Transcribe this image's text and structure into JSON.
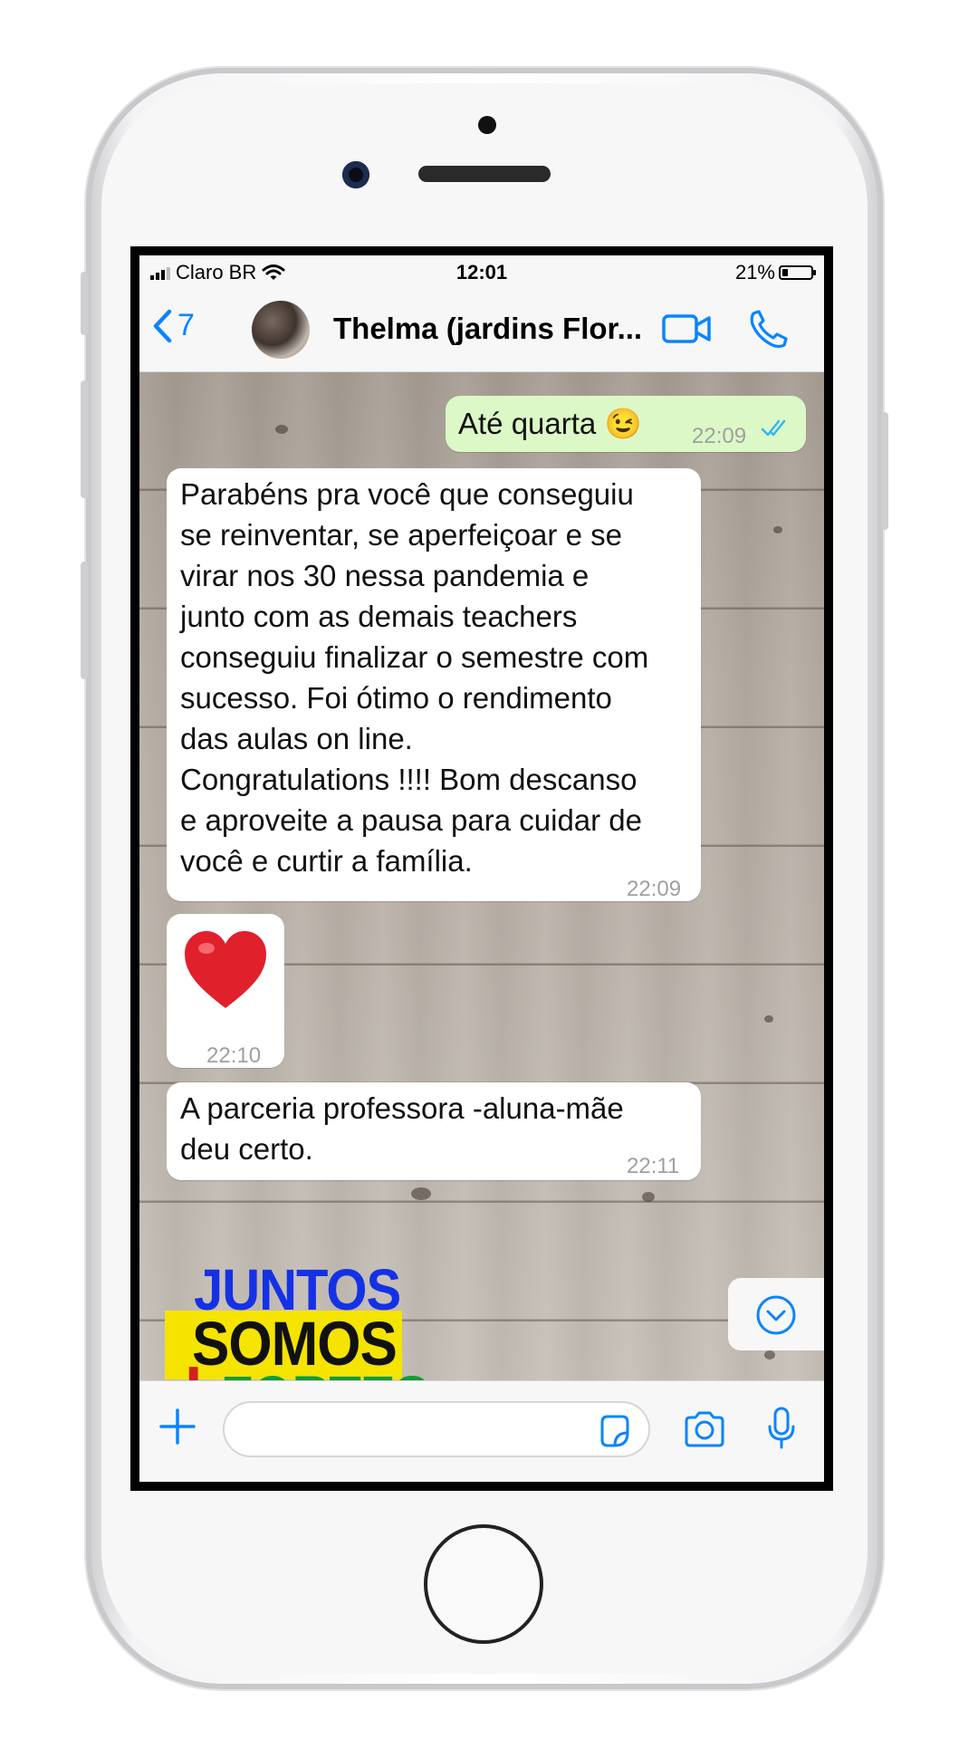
{
  "status_bar": {
    "carrier": "Claro BR",
    "time": "12:01",
    "battery_percent": "21%",
    "battery_level": 0.21
  },
  "header": {
    "back_count": "7",
    "contact_name": "Thelma (jardins Flor..."
  },
  "messages": [
    {
      "direction": "outgoing",
      "text": "Até quarta 😉",
      "time": "22:09",
      "status": "read"
    },
    {
      "direction": "incoming",
      "text": "Parabéns pra você que conseguiu\nse reinventar, se aperfeiçoar e se\nvirar nos 30 nessa pandemia e\njunto com as demais teachers\nconseguiu finalizar o semestre com\nsucesso. Foi ótimo o rendimento\ndas aulas on line.\nCongratulations !!!! Bom descanso\ne aproveite a pausa para cuidar de\nvocê e curtir a família.",
      "time": "22:09"
    },
    {
      "direction": "incoming",
      "text": "❤️",
      "time": "22:10"
    },
    {
      "direction": "incoming",
      "text": "A parceria professora -aluna-mãe\ndeu certo.",
      "time": "22:11"
    }
  ],
  "sticker": {
    "line1": "JUNTOS",
    "line2": "SOMOS",
    "line3": "FORTES",
    "plus": "+"
  },
  "input": {
    "placeholder": ""
  },
  "colors": {
    "accent": "#0a84ff",
    "outgoing_bubble": "#dcf8c6",
    "incoming_bubble": "#ffffff",
    "read_ticks": "#34b7f1"
  },
  "icons": [
    "chevron-left-icon",
    "video-camera-icon",
    "phone-icon",
    "chevron-down-icon",
    "plus-icon",
    "sticker-icon",
    "camera-icon",
    "microphone-icon",
    "double-check-icon",
    "wifi-icon",
    "signal-icon",
    "battery-icon"
  ]
}
